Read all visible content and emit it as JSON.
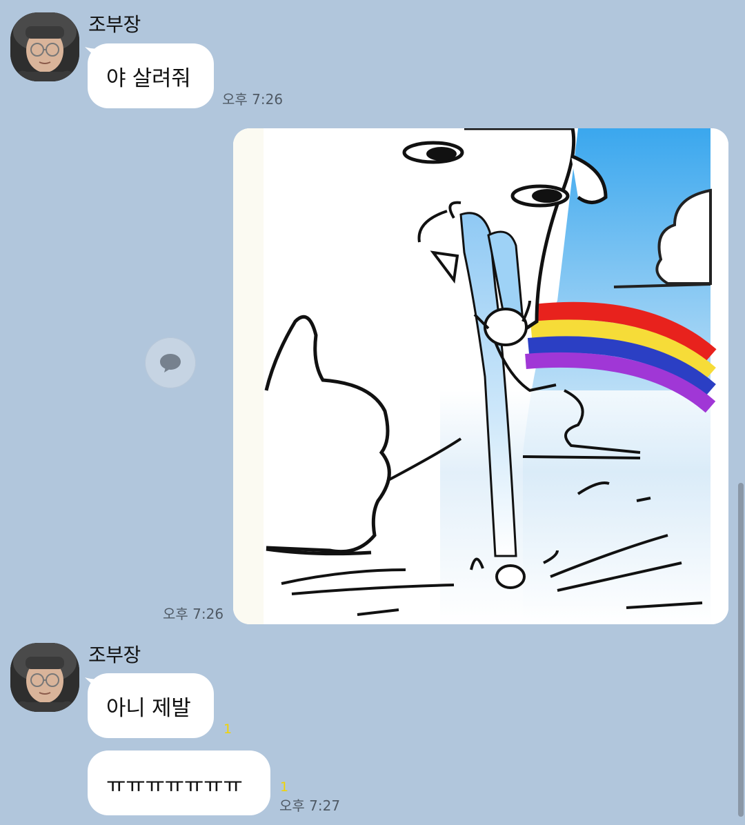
{
  "messages": [
    {
      "sender": "조부장",
      "bubbles": [
        {
          "text": "야 살려줘",
          "time": "오후 7:26"
        }
      ]
    },
    {
      "type": "image",
      "image_label": "rainbow vomit cartoon",
      "time": "오후 7:26"
    },
    {
      "sender": "조부장",
      "bubbles": [
        {
          "text": "아니 제발",
          "unread": "1"
        },
        {
          "text": "ㅠㅠㅠㅠㅠㅠㅠ",
          "unread": "1",
          "time": "오후 7:27"
        }
      ]
    }
  ],
  "icons": {
    "share": "speech-bubble-icon"
  },
  "colors": {
    "background": "#b1c6dc",
    "bubble": "#ffffff",
    "unread": "#f2d400",
    "timestamp": "#4f5964"
  }
}
